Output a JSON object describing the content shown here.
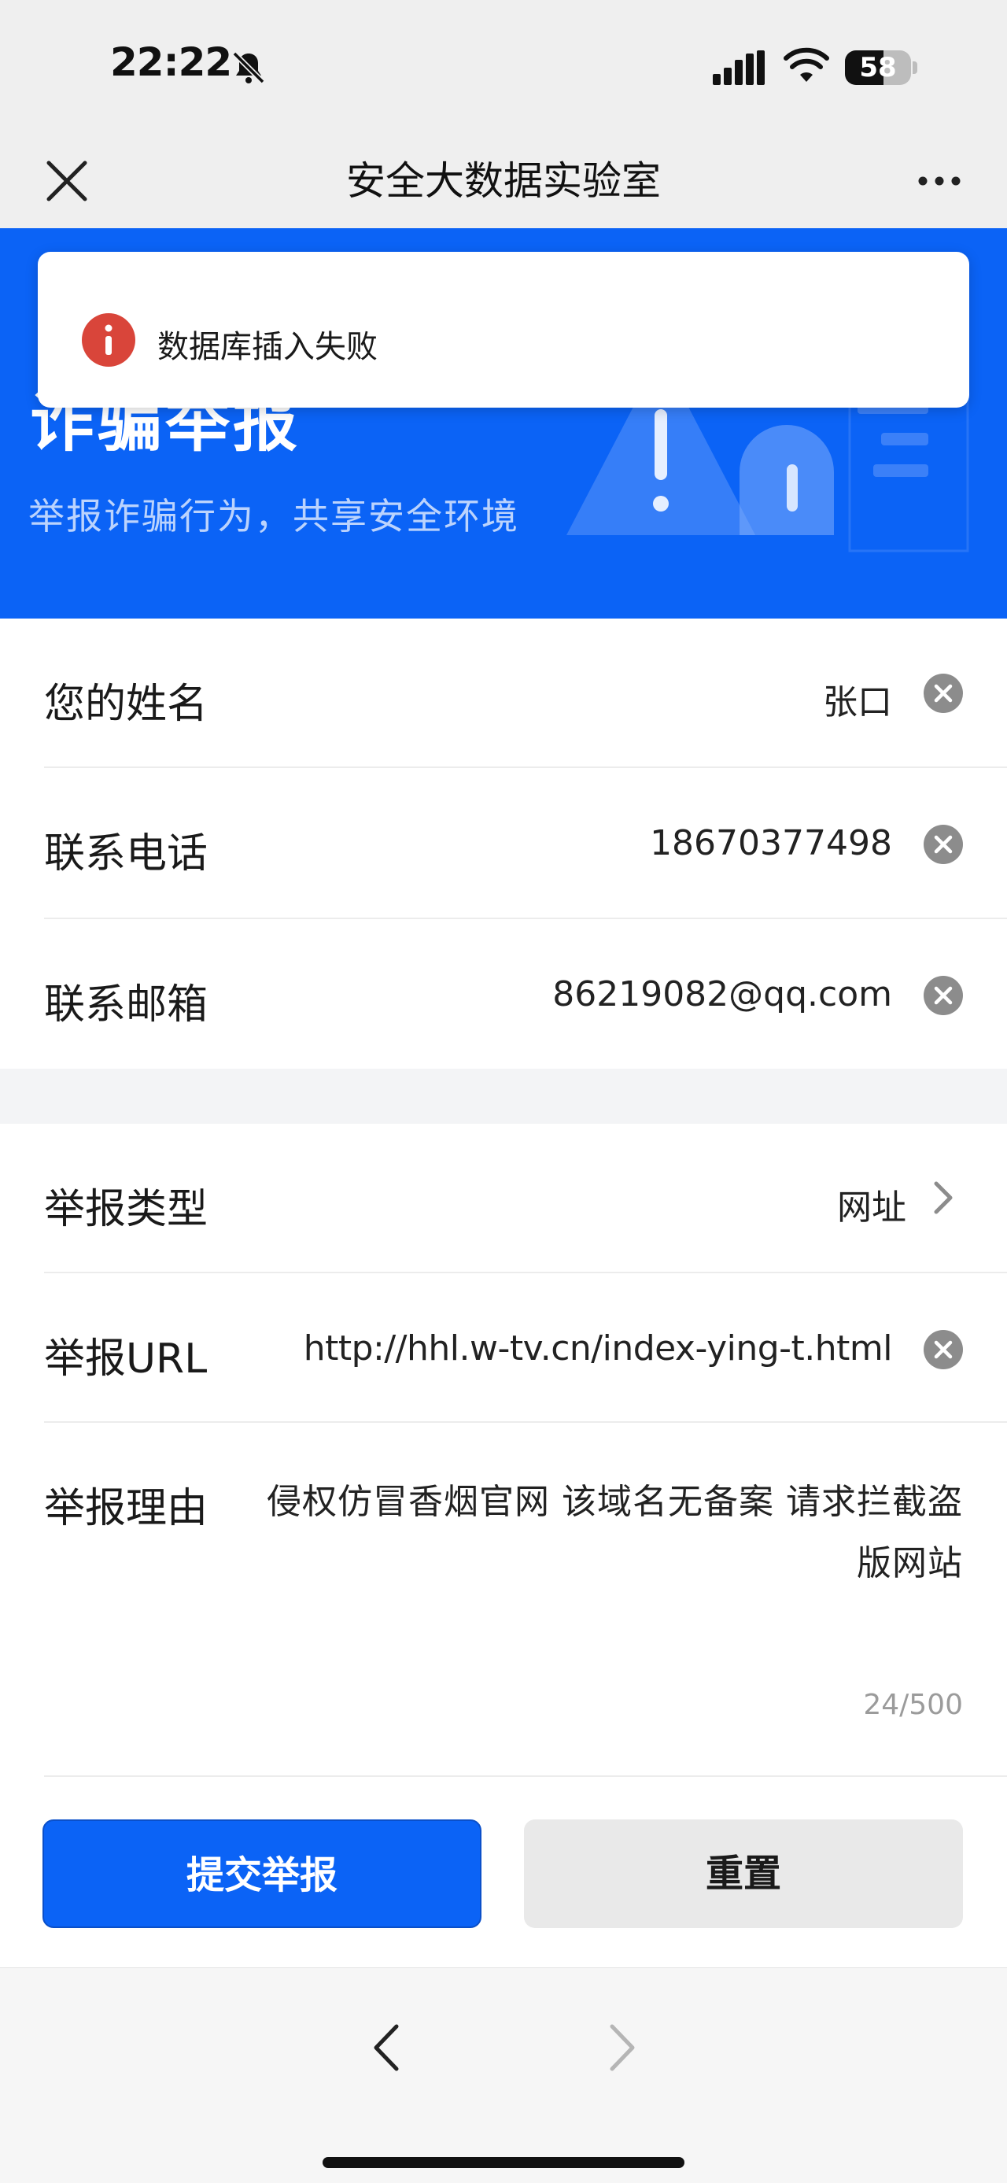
{
  "status_bar": {
    "time": "22:22",
    "battery_level": "58",
    "battery_fraction": 0.58
  },
  "nav": {
    "title": "安全大数据实验室"
  },
  "banner": {
    "title": "诈骗举报",
    "subtitle": "举报诈骗行为，共享安全环境"
  },
  "toast": {
    "message": "数据库插入失败"
  },
  "form": {
    "name": {
      "label": "您的姓名",
      "value": "张口"
    },
    "phone": {
      "label": "联系电话",
      "value": "18670377498"
    },
    "email": {
      "label": "联系邮箱",
      "value": "86219082@qq.com"
    },
    "report_type": {
      "label": "举报类型",
      "value": "网址"
    },
    "report_url": {
      "label": "举报URL",
      "value": "http://hhl.w-tv.cn/index-ying-t.html"
    },
    "report_reason": {
      "label": "举报理由",
      "value": "侵权仿冒香烟官网 该域名无备案 请求拦截盗版网站",
      "count": "24/500"
    }
  },
  "buttons": {
    "submit": "提交举报",
    "reset": "重置"
  },
  "icons": {
    "mute": "bell-slash-icon",
    "signal": "cellular-signal-icon",
    "wifi": "wifi-icon",
    "close": "close-icon",
    "more": "more-icon",
    "toast": "info-circle-icon",
    "clear": "clear-circle-icon",
    "chevron": "chevron-right-icon",
    "back": "back-arrow-icon",
    "forward": "forward-arrow-icon"
  },
  "colors": {
    "brand_blue": "#0b63f6",
    "toast_red": "#d9453a",
    "page_gray": "#f3f4f6",
    "clear_gray": "#8c8c8c"
  }
}
